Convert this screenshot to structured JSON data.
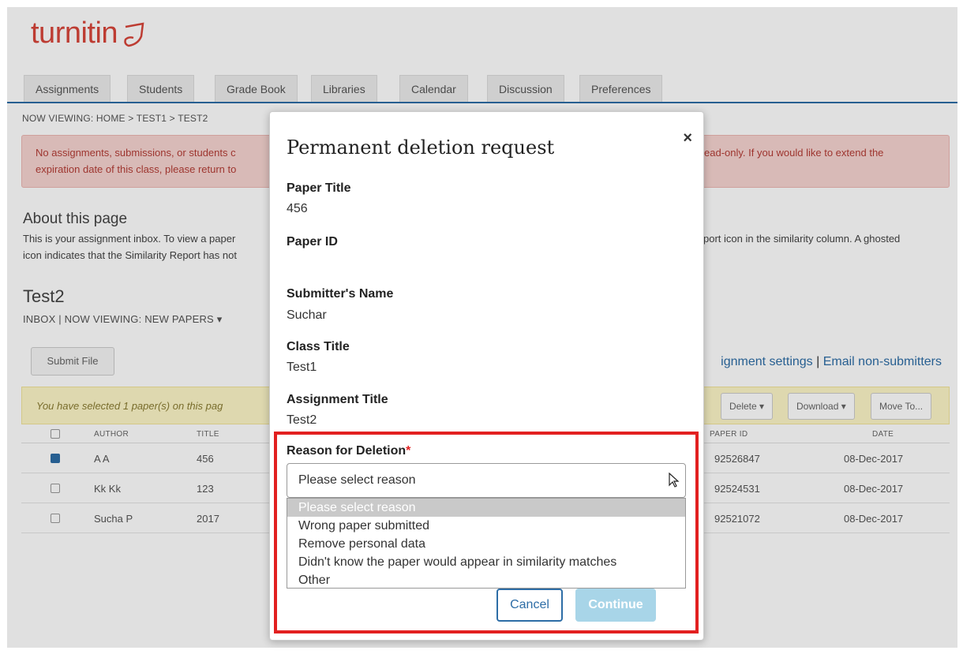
{
  "header": {
    "logo_text": "turnitin",
    "tabs": [
      "Assignments",
      "Students",
      "Grade Book",
      "Libraries",
      "Calendar",
      "Discussion",
      "Preferences"
    ]
  },
  "breadcrumb": "NOW VIEWING: HOME > TEST1 > TEST2",
  "alert": {
    "line1_left": "No assignments, submissions, or students c",
    "line1_right": "ead-only. If you would like to extend the",
    "line2_left": "expiration date of this class, please return to"
  },
  "about": {
    "title": "About this page",
    "line1_left": "This is your assignment inbox. To view a paper",
    "line1_right": "port icon in the similarity column. A ghosted",
    "line2_left": "icon indicates that the Similarity Report has not"
  },
  "class": {
    "title": "Test2",
    "inbox_line": "INBOX | NOW VIEWING: NEW PAPERS ▾"
  },
  "toolbar": {
    "submit_file": "Submit File",
    "assignment_settings": "ignment settings",
    "separator": " | ",
    "email_non_submitters": "Email non-submitters"
  },
  "selection_bar": {
    "text": "You have selected 1 paper(s) on this pag",
    "delete": "Delete ▾",
    "download": "Download ▾",
    "move_to": "Move To..."
  },
  "table": {
    "headers": {
      "author": "AUTHOR",
      "title": "TITLE",
      "paper_id": "PAPER ID",
      "date": "DATE"
    },
    "rows": [
      {
        "checked": true,
        "author": "A A",
        "title": "456",
        "paper_id": "92526847",
        "date": "08-Dec-2017"
      },
      {
        "checked": false,
        "author": "Kk Kk",
        "title": "123",
        "paper_id": "92524531",
        "date": "08-Dec-2017"
      },
      {
        "checked": false,
        "author": "Sucha P",
        "title": "2017",
        "paper_id": "92521072",
        "date": "08-Dec-2017"
      }
    ]
  },
  "modal": {
    "title": "Permanent deletion request",
    "close": "×",
    "fields": [
      {
        "label": "Paper Title",
        "value": "456"
      },
      {
        "label": "Paper ID",
        "value": ""
      },
      {
        "label": "Submitter's Name",
        "value": "Suchar"
      },
      {
        "label": "Class Title",
        "value": "Test1"
      },
      {
        "label": "Assignment Title",
        "value": "Test2"
      }
    ],
    "reason": {
      "label": "Reason for Deletion",
      "required_mark": "*",
      "selected": "Please select reason",
      "options": [
        "Please select reason",
        "Wrong paper submitted",
        "Remove personal data",
        "Didn't know the paper would appear in similarity matches",
        "Other"
      ]
    },
    "cancel_label": "Cancel",
    "continue_label": "Continue"
  },
  "colors": {
    "brand_red": "#d8453a",
    "link_blue": "#2d6da6",
    "highlight_red": "#e22020",
    "continue_disabled": "#a8d5e8"
  }
}
